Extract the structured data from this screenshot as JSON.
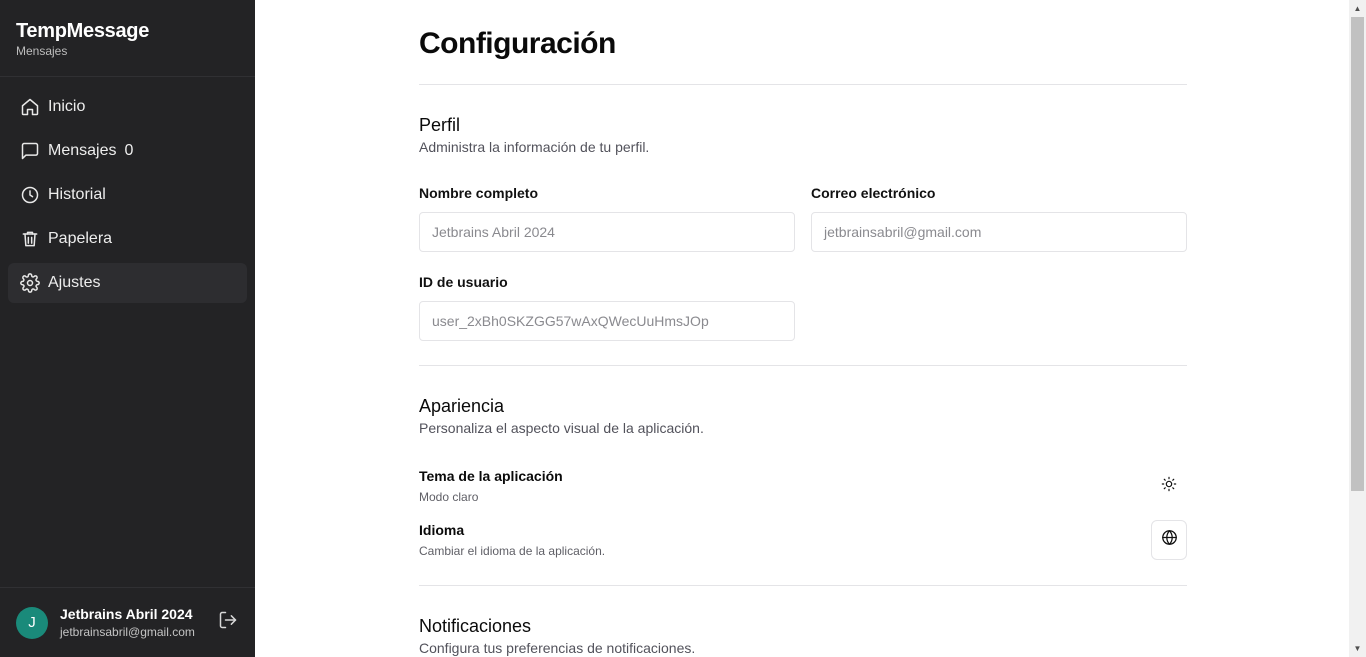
{
  "sidebar": {
    "brand_title": "TempMessage",
    "brand_subtitle": "Mensajes",
    "items": [
      {
        "label": "Inicio",
        "icon": "home-icon"
      },
      {
        "label": "Mensajes",
        "icon": "message-square-icon",
        "count": "0"
      },
      {
        "label": "Historial",
        "icon": "clock-icon"
      },
      {
        "label": "Papelera",
        "icon": "trash-icon"
      },
      {
        "label": "Ajustes",
        "icon": "gear-icon",
        "active": true
      }
    ],
    "user": {
      "initial": "J",
      "name": "Jetbrains Abril 2024",
      "email": "jetbrainsabril@gmail.com"
    }
  },
  "main": {
    "title": "Configuración",
    "profile": {
      "title": "Perfil",
      "description": "Administra la información de tu perfil.",
      "full_name_label": "Nombre completo",
      "full_name_value": "Jetbrains Abril 2024",
      "email_label": "Correo electrónico",
      "email_value": "jetbrainsabril@gmail.com",
      "user_id_label": "ID de usuario",
      "user_id_value": "user_2xBh0SKZGG57wAxQWecUuHmsJOp"
    },
    "appearance": {
      "title": "Apariencia",
      "description": "Personaliza el aspecto visual de la aplicación.",
      "theme_title": "Tema de la aplicación",
      "theme_desc": "Modo claro",
      "language_title": "Idioma",
      "language_desc": "Cambiar el idioma de la aplicación."
    },
    "notifications": {
      "title": "Notificaciones",
      "description": "Configura tus preferencias de notificaciones."
    }
  },
  "colors": {
    "sidebar_bg": "#232325",
    "avatar_bg": "#1a8a7a",
    "border": "#e4e4e7"
  }
}
